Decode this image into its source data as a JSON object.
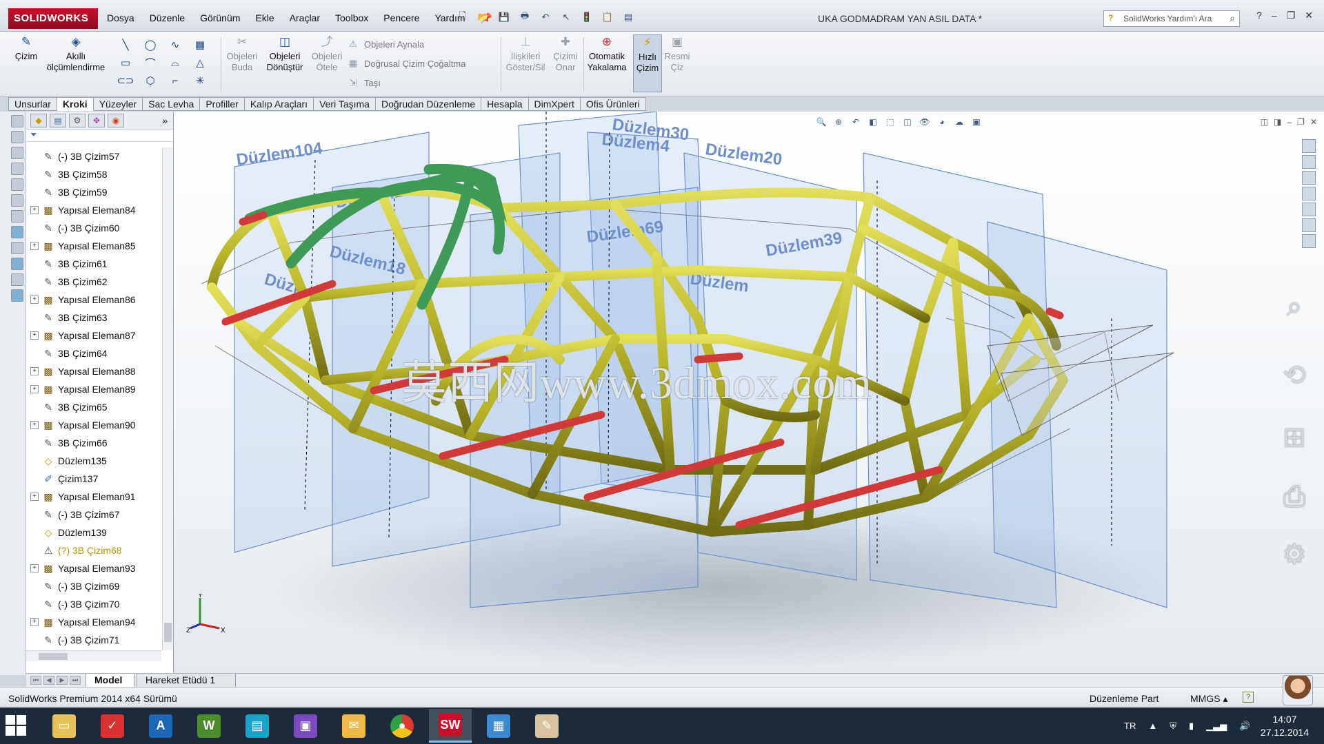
{
  "app": {
    "brand": "SOLIDWORKS",
    "document_title": "UKA GODMADRAM YAN ASIL DATA *"
  },
  "menu": [
    "Dosya",
    "Düzenle",
    "Görünüm",
    "Ekle",
    "Araçlar",
    "Toolbox",
    "Pencere",
    "Yardım"
  ],
  "help_search": {
    "placeholder": "SolidWorks Yardım'ı Ara"
  },
  "command_manager": {
    "sketch": "Çizim",
    "smart_dimension": [
      "Akıllı",
      "ölçümlendirme"
    ],
    "trim": [
      "Objeleri",
      "Buda"
    ],
    "convert": [
      "Objeleri",
      "Dönüştür"
    ],
    "offset": [
      "Objeleri",
      "Ötele"
    ],
    "mirror": "Objeleri Aynala",
    "linear_pattern": "Doğrusal Çizim Çoğaltma",
    "move": "Taşı",
    "relations": [
      "İlişkileri",
      "Göster/Sil"
    ],
    "repair": [
      "Çizimi",
      "Onar"
    ],
    "snaps": [
      "Otomatik",
      "Yakalama"
    ],
    "rapid_sketch": [
      "Hızlı",
      "Çizim"
    ],
    "sketch_picture": [
      "Resmi",
      "Çiz"
    ]
  },
  "tabs": [
    {
      "label": "Unsurlar",
      "active": false
    },
    {
      "label": "Kroki",
      "active": true
    },
    {
      "label": "Yüzeyler",
      "active": false
    },
    {
      "label": "Sac Levha",
      "active": false
    },
    {
      "label": "Profiller",
      "active": false
    },
    {
      "label": "Kalıp Araçları",
      "active": false
    },
    {
      "label": "Veri Taşıma",
      "active": false
    },
    {
      "label": "Doğrudan Düzenleme",
      "active": false
    },
    {
      "label": "Hesapla",
      "active": false
    },
    {
      "label": "DimXpert",
      "active": false
    },
    {
      "label": "Ofis Ürünleri",
      "active": false
    }
  ],
  "tree": [
    {
      "label": "(-) 3B Çizim57",
      "type": "sketch",
      "expandable": false
    },
    {
      "label": "3B Çizim58",
      "type": "sketch",
      "expandable": false
    },
    {
      "label": "3B Çizim59",
      "type": "sketch",
      "expandable": false
    },
    {
      "label": "Yapısal Eleman84",
      "type": "weld",
      "expandable": true
    },
    {
      "label": "(-) 3B Çizim60",
      "type": "sketch",
      "expandable": false
    },
    {
      "label": "Yapısal Eleman85",
      "type": "weld",
      "expandable": true
    },
    {
      "label": "3B Çizim61",
      "type": "sketch",
      "expandable": false
    },
    {
      "label": "3B Çizim62",
      "type": "sketch",
      "expandable": false
    },
    {
      "label": "Yapısal Eleman86",
      "type": "weld",
      "expandable": true
    },
    {
      "label": "3B Çizim63",
      "type": "sketch",
      "expandable": false
    },
    {
      "label": "Yapısal Eleman87",
      "type": "weld",
      "expandable": true
    },
    {
      "label": "3B Çizim64",
      "type": "sketch",
      "expandable": false
    },
    {
      "label": "Yapısal Eleman88",
      "type": "weld",
      "expandable": true
    },
    {
      "label": "Yapısal Eleman89",
      "type": "weld",
      "expandable": true
    },
    {
      "label": "3B Çizim65",
      "type": "sketch",
      "expandable": false
    },
    {
      "label": "Yapısal Eleman90",
      "type": "weld",
      "expandable": true
    },
    {
      "label": "3B Çizim66",
      "type": "sketch",
      "expandable": false
    },
    {
      "label": "Düzlem135",
      "type": "plane",
      "expandable": false
    },
    {
      "label": "Çizim137",
      "type": "sketch2d",
      "expandable": false
    },
    {
      "label": "Yapısal Eleman91",
      "type": "weld",
      "expandable": true
    },
    {
      "label": "(-) 3B Çizim67",
      "type": "sketch",
      "expandable": false
    },
    {
      "label": "Düzlem139",
      "type": "plane",
      "expandable": false
    },
    {
      "label": "(?) 3B Çizim68",
      "type": "sketch",
      "expandable": false,
      "warning": true
    },
    {
      "label": "Yapısal Eleman93",
      "type": "weld",
      "expandable": true
    },
    {
      "label": "(-) 3B Çizim69",
      "type": "sketch",
      "expandable": false
    },
    {
      "label": "(-) 3B Çizim70",
      "type": "sketch",
      "expandable": false
    },
    {
      "label": "Yapısal Eleman94",
      "type": "weld",
      "expandable": true
    },
    {
      "label": "(-) 3B Çizim71",
      "type": "sketch",
      "expandable": false
    }
  ],
  "viewport": {
    "plane_labels": [
      "Düzlem104",
      "Düzlem16",
      "Düzlem4",
      "Düzlem30",
      "Düzlem20",
      "Düzlem69",
      "Düzlem18",
      "Düzlem39",
      "Düzlem",
      "Düzlem"
    ],
    "watermark": "莫西网www.3dmox.com",
    "triad": {
      "y": "Y",
      "x": "X",
      "z": "Z"
    },
    "colors": {
      "frame": "#b9b52a",
      "roll_hoop": "#3f9a57",
      "cross_members": "#d23a3a",
      "planes": "#7fa3d8"
    }
  },
  "model_tabs": [
    {
      "label": "Model",
      "active": true
    },
    {
      "label": "Hareket Etüdü 1",
      "active": false
    }
  ],
  "status": {
    "left": "SolidWorks Premium 2014 x64 Sürümü",
    "mode": "Düzenleme Part",
    "units": "MMGS"
  },
  "taskbar": {
    "language": "TR",
    "time": "14:07",
    "date": "27.12.2014",
    "apps": [
      "file-explorer",
      "to-do",
      "autodesk",
      "games",
      "viewer",
      "media",
      "outlook",
      "chrome",
      "solidworks",
      "photos",
      "paint"
    ]
  }
}
